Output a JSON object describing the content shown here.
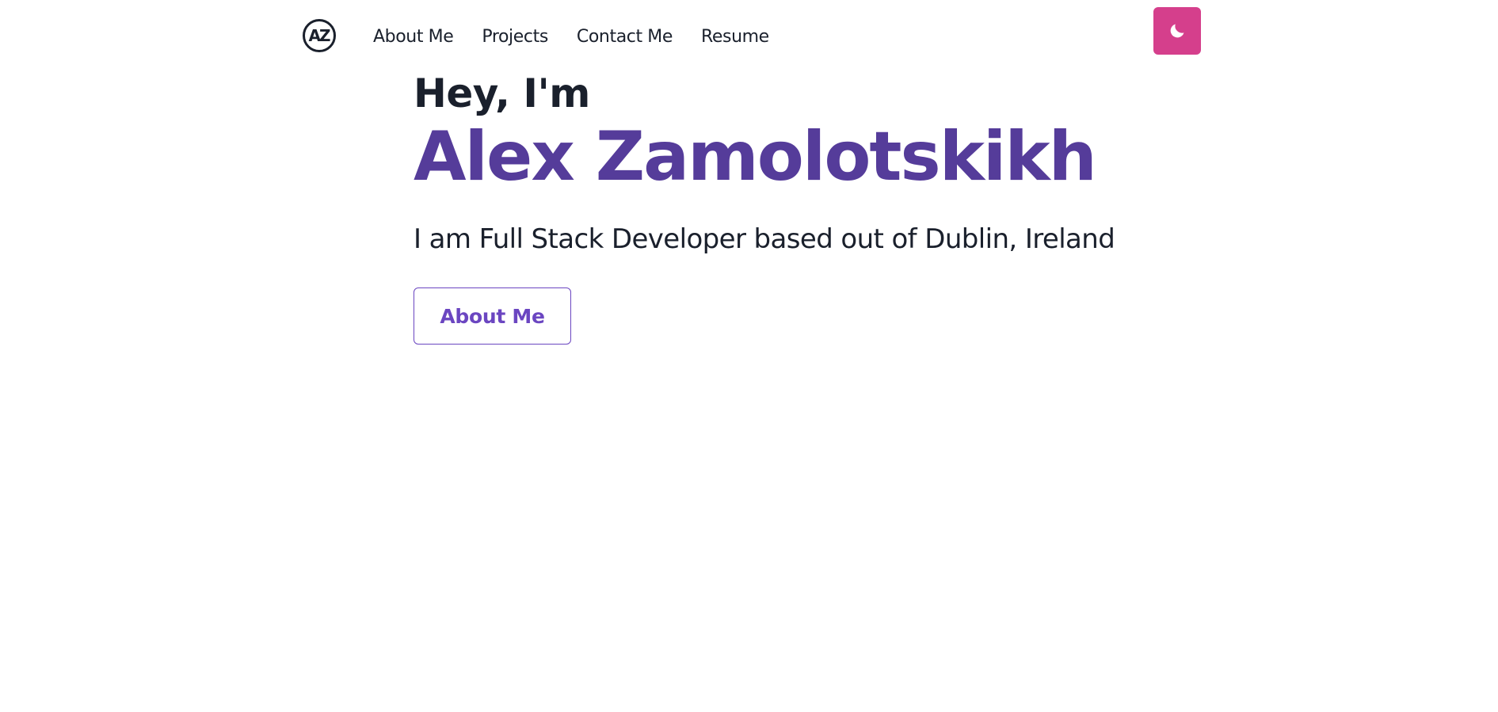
{
  "header": {
    "logo_text": "AZ",
    "nav_links": [
      {
        "label": "About Me"
      },
      {
        "label": "Projects"
      },
      {
        "label": "Contact Me"
      },
      {
        "label": "Resume"
      }
    ],
    "theme_toggle_icon": "moon-icon"
  },
  "hero": {
    "greeting": "Hey, I'm",
    "name": "Alex Zamolotskikh",
    "tagline": "I am Full Stack Developer based out of Dublin, Ireland",
    "cta_label": "About Me"
  },
  "colors": {
    "text": "#1a202c",
    "name_purple": "#553c9a",
    "button_purple": "#6b46c1",
    "toggle_pink": "#d53f8c",
    "background": "#ffffff"
  }
}
